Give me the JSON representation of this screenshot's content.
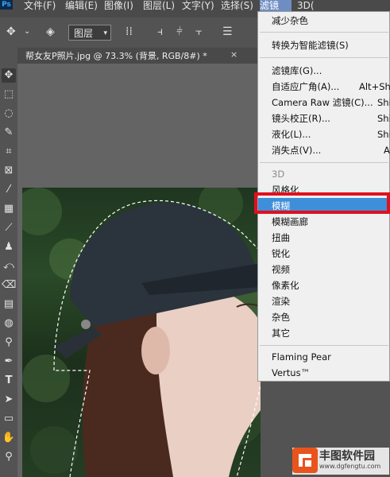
{
  "app": {
    "logo": "Ps"
  },
  "menubar": {
    "items": [
      "文件(F)",
      "编辑(E)",
      "图像(I)",
      "图层(L)",
      "文字(Y)",
      "选择(S)",
      "滤镜(T)",
      "3D("
    ]
  },
  "options": {
    "layer_select": "图层",
    "icons": [
      "move-icon",
      "chevron-down-icon",
      "layers-icon",
      "align-icons"
    ]
  },
  "document": {
    "tab_title": "帮女友P照片.jpg @ 73.3% (背景, RGB/8#) *",
    "close_glyph": "×"
  },
  "filter_menu": {
    "group1": [
      {
        "label": "减少杂色",
        "shortcut": ""
      }
    ],
    "group2": [
      {
        "label": "转换为智能滤镜(S)",
        "shortcut": ""
      }
    ],
    "group3": [
      {
        "label": "滤镜库(G)...",
        "shortcut": ""
      },
      {
        "label": "自适应广角(A)...",
        "shortcut": "Alt+Shi"
      },
      {
        "label": "Camera Raw 滤镜(C)...",
        "shortcut": "Shi"
      },
      {
        "label": "镜头校正(R)...",
        "shortcut": "Shi"
      },
      {
        "label": "液化(L)...",
        "shortcut": "Shi"
      },
      {
        "label": "消失点(V)...",
        "shortcut": "A"
      }
    ],
    "group4": [
      {
        "label": "3D",
        "disabled": true
      },
      {
        "label": "风格化"
      },
      {
        "label": "模糊",
        "highlighted": true
      },
      {
        "label": "模糊画廊"
      },
      {
        "label": "扭曲"
      },
      {
        "label": "锐化"
      },
      {
        "label": "视频"
      },
      {
        "label": "像素化"
      },
      {
        "label": "渲染"
      },
      {
        "label": "杂色"
      },
      {
        "label": "其它"
      }
    ],
    "group5": [
      {
        "label": "Flaming Pear"
      },
      {
        "label": "Vertus™"
      }
    ]
  },
  "watermark": {
    "text": "丰图软件园",
    "url": "www.dgfengtu.com"
  },
  "colors": {
    "menu_highlight": "#3f8ed9",
    "annotation": "#e0101c",
    "menubar_active": "#6e8ec3"
  }
}
